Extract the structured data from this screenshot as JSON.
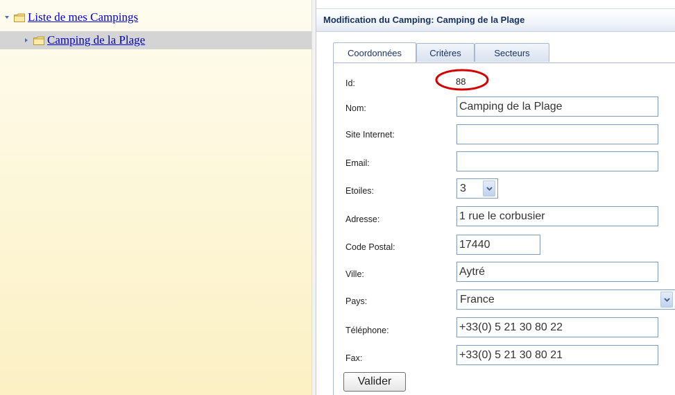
{
  "tree": {
    "root_label": "Liste de mes Campings",
    "child_label": "Camping de la Plage"
  },
  "editor": {
    "title": "Modification du Camping: Camping de la Plage",
    "tabs": [
      "Coordonnées",
      "Critères",
      "Secteurs"
    ],
    "active_tab": "Coordonnées"
  },
  "form": {
    "id_label": "Id:",
    "id_value": "88",
    "nom_label": "Nom:",
    "nom_value": "Camping de la Plage",
    "site_label": "Site Internet:",
    "site_value": "",
    "email_label": "Email:",
    "email_value": "",
    "etoiles_label": "Etoiles:",
    "etoiles_value": "3",
    "adresse_label": "Adresse:",
    "adresse_value": "1 rue le corbusier",
    "cp_label": "Code Postal:",
    "cp_value": "17440",
    "ville_label": "Ville:",
    "ville_value": "Aytré",
    "pays_label": "Pays:",
    "pays_value": "France",
    "tel_label": "Téléphone:",
    "tel_value": "+33(0) 5 21 30 80 22",
    "fax_label": "Fax:",
    "fax_value": "+33(0) 5 21 30 80 21",
    "submit_label": "Valider"
  },
  "colors": {
    "link": "#0000cc",
    "title": "#15315d",
    "highlight_circle": "#d40000",
    "tree_bg": "#fdf6d6",
    "selected_row": "#d4d4d4"
  }
}
